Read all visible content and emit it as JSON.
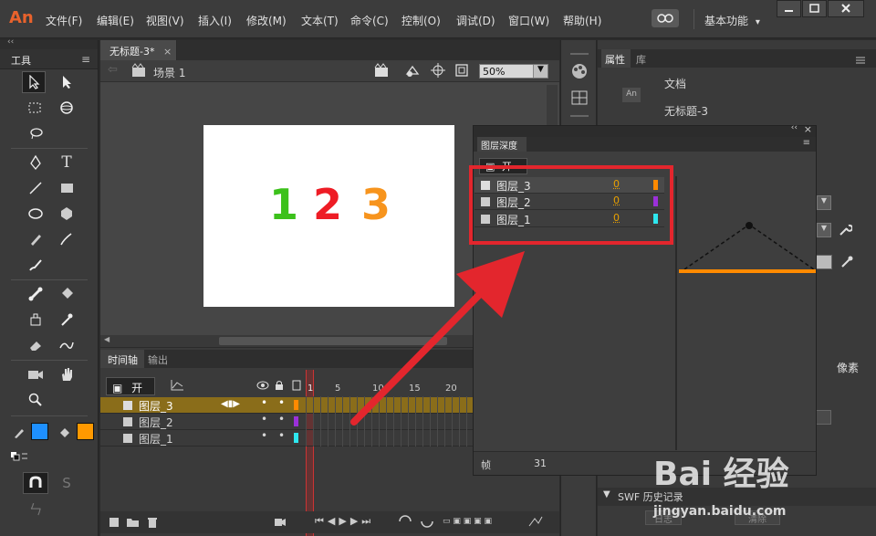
{
  "app": {
    "logo": "An"
  },
  "menu": [
    "文件(F)",
    "编辑(E)",
    "视图(V)",
    "插入(I)",
    "修改(M)",
    "文本(T)",
    "命令(C)",
    "控制(O)",
    "调试(D)",
    "窗口(W)",
    "帮助(H)"
  ],
  "workspace": {
    "label": "基本功能",
    "arrow": "▾"
  },
  "tools_panel": {
    "title": "工具"
  },
  "document": {
    "tab_title": "无标题-3*",
    "tab_close": "×",
    "scene": "场景 1",
    "zoom": "50%",
    "stage_numbers": [
      {
        "text": "1",
        "color": "#3cc11b"
      },
      {
        "text": "2",
        "color": "#ee1c25"
      },
      {
        "text": "3",
        "color": "#f7941d"
      }
    ]
  },
  "timeline": {
    "tabs": [
      "时间轴",
      "输出"
    ],
    "onion_label": "开",
    "frame_ticks": [
      "1",
      "5",
      "10",
      "15",
      "20"
    ],
    "layers": [
      {
        "name": "图层_3",
        "color": "#ff8a00",
        "selected": true
      },
      {
        "name": "图层_2",
        "color": "#9b30d9",
        "selected": false
      },
      {
        "name": "图层_1",
        "color": "#2ee7ef",
        "selected": false
      }
    ]
  },
  "properties": {
    "tabs": [
      "属性",
      "库"
    ],
    "doc_label": "文档",
    "doc_name": "无标题-3",
    "doc_icon": "An",
    "unit_label": "像素",
    "swf_history": "SWF 历史记录",
    "footer_buttons": [
      "日志",
      "清除"
    ]
  },
  "depth_panel": {
    "title": "图层深度",
    "toggle_label": "开",
    "layers": [
      {
        "name": "图层_3",
        "depth": "0",
        "color": "#ff8a00"
      },
      {
        "name": "图层_2",
        "depth": "0",
        "color": "#9b30d9"
      },
      {
        "name": "图层_1",
        "depth": "0",
        "color": "#2ee7ef"
      }
    ],
    "frame_label": "帧",
    "frame_value": "31"
  },
  "watermark": {
    "text": "Bai 经验",
    "url": "jingyan.baidu.com"
  },
  "colors": {
    "accent_orange": "#ff8a00",
    "highlight_red": "#e3262d",
    "stroke_color": "#1e90ff",
    "fill_color": "#ff9900"
  }
}
